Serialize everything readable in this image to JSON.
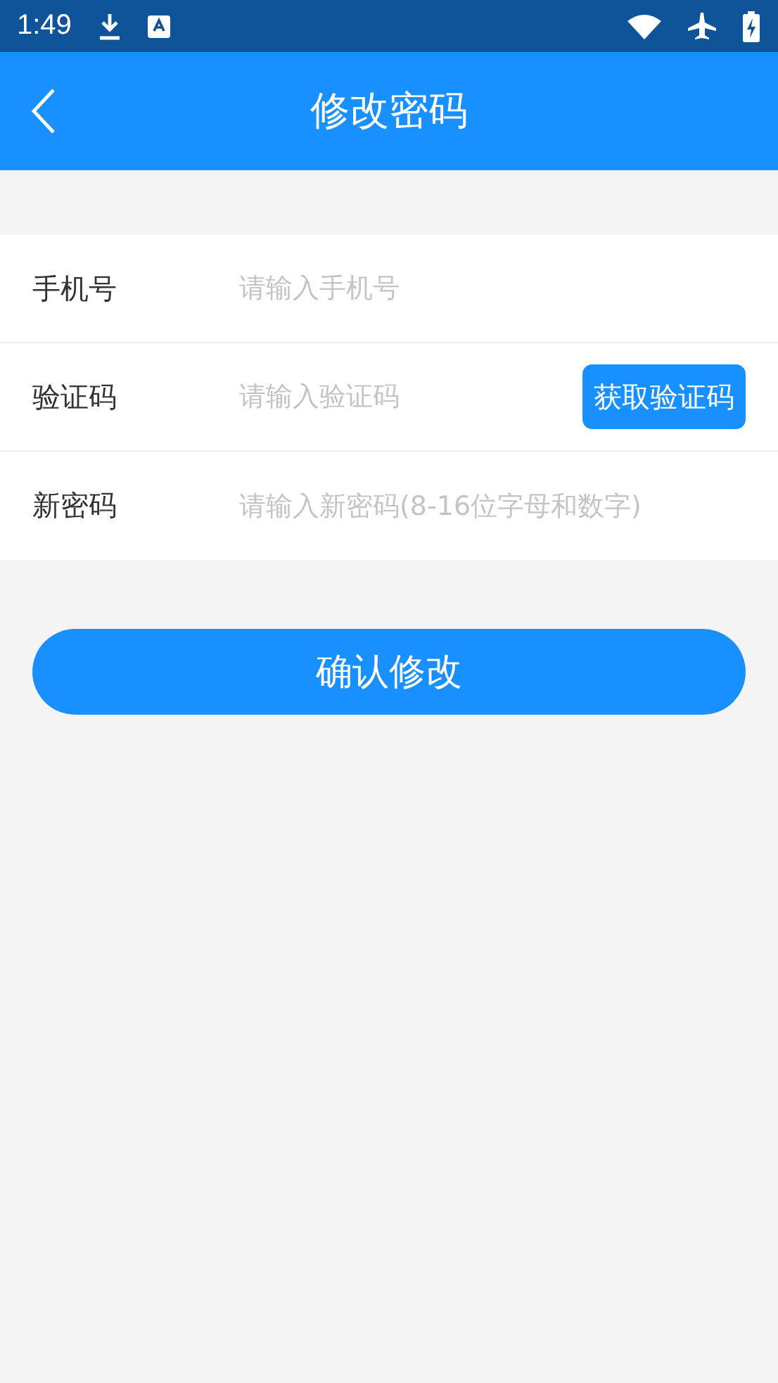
{
  "status_bar": {
    "time": "1:49"
  },
  "header": {
    "title": "修改密码"
  },
  "fields": [
    {
      "label": "手机号",
      "placeholder": "请输入手机号"
    },
    {
      "label": "验证码",
      "placeholder": "请输入验证码",
      "action": "获取验证码"
    },
    {
      "label": "新密码",
      "placeholder": "请输入新密码(8-16位字母和数字)"
    }
  ],
  "submit": "确认修改"
}
